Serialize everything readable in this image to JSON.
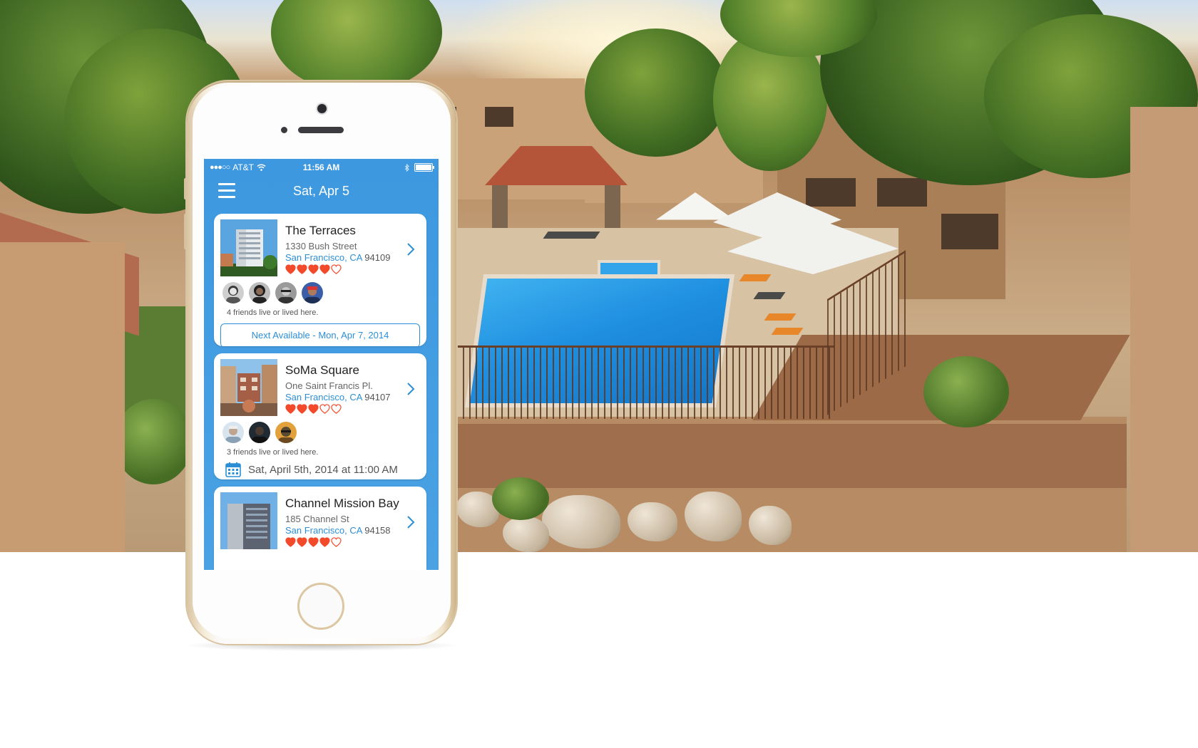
{
  "status_bar": {
    "carrier": "AT&T",
    "time": "11:56 AM"
  },
  "nav": {
    "title": "Sat, Apr 5"
  },
  "listings": [
    {
      "name": "The Terraces",
      "street": "1330 Bush Street",
      "city": "San Francisco, CA",
      "zip": "94109",
      "rating": 4,
      "max_rating": 5,
      "friends_text": "4 friends live or lived here.",
      "action_label": "Next Available - Mon, Apr 7, 2014"
    },
    {
      "name": "SoMa Square",
      "street": "One Saint Francis Pl.",
      "city": "San Francisco, CA",
      "zip": "94107",
      "rating": 3,
      "max_rating": 5,
      "friends_text": "3 friends live or lived here.",
      "scheduled_label": "Sat, April 5th, 2014 at 11:00 AM"
    },
    {
      "name": "Channel Mission Bay",
      "street": "185 Channel St",
      "city": "San Francisco, CA",
      "zip": "94158",
      "rating": 4,
      "max_rating": 5
    }
  ],
  "colors": {
    "accent": "#2c8fd6",
    "nav_bar": "#3d98df",
    "heart": "#f24a2a"
  },
  "icons": [
    "menu-icon",
    "wifi-icon",
    "bluetooth-icon",
    "battery-icon",
    "chevron-right-icon",
    "heart-icon",
    "calendar-icon"
  ]
}
